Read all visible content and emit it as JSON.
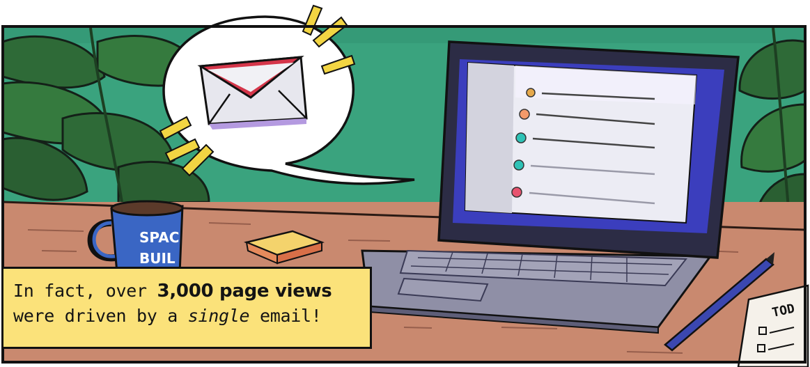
{
  "caption": {
    "line1_prefix": "In fact, over ",
    "line1_bold": "3,000 page views",
    "line2_prefix": "were driven by a ",
    "line2_italic": "single",
    "line2_suffix": " email!"
  },
  "mug": {
    "text_top": "SPAC",
    "text_bottom": "BUIL"
  },
  "todo_note": {
    "text": "TOD"
  },
  "icons": [
    "email-envelope-icon",
    "speech-bubble",
    "laptop",
    "coffee-mug",
    "sticky-note",
    "pen",
    "todo-note"
  ],
  "colors": {
    "wall": "#3aa37e",
    "desk": "#c9896f",
    "caption_bg": "#fbe27a",
    "laptop": "#8f8fa6",
    "screen_bezel": "#2c2c45",
    "mug": "#3a66c4",
    "envelope_red": "#d5364a"
  }
}
